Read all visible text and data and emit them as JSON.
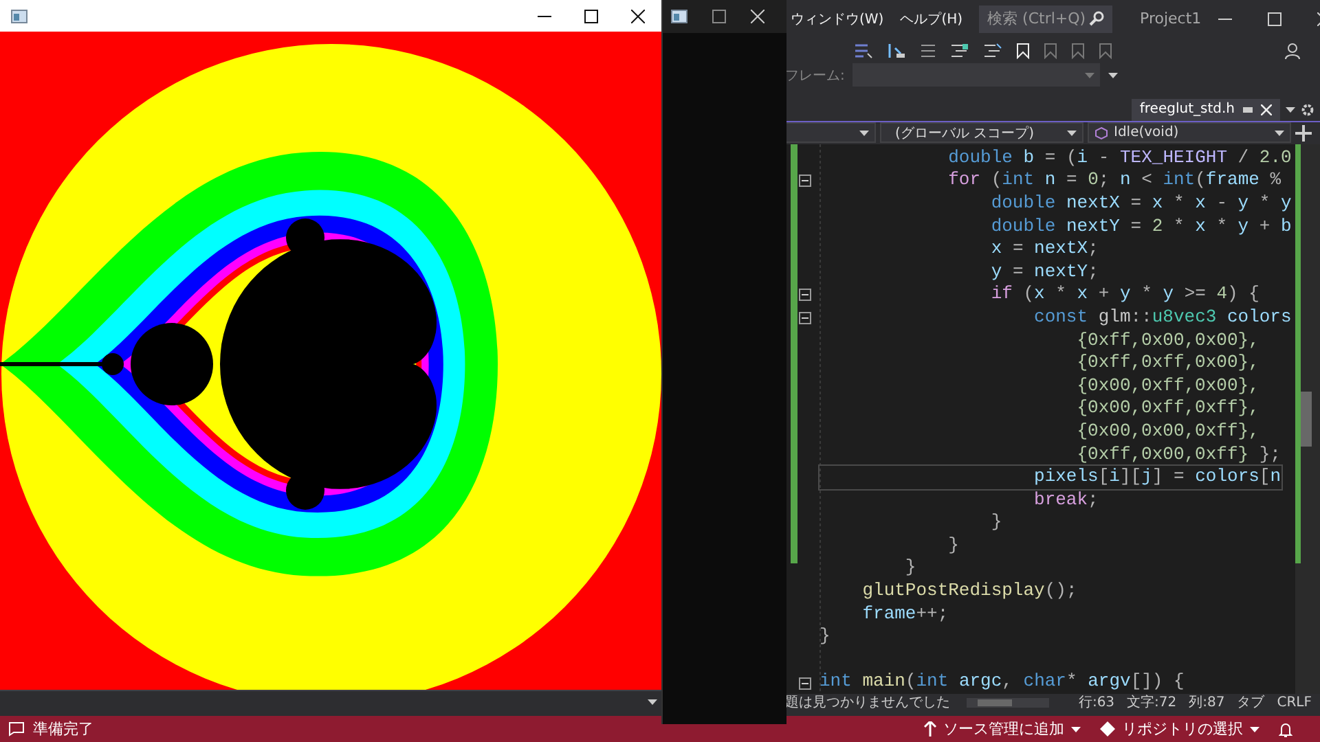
{
  "menu": [
    "ウィンドウ(W)",
    "ヘルプ(H)"
  ],
  "search": {
    "placeholder": "検索 (Ctrl+Q)"
  },
  "project_name": "Project1",
  "debug_toolbar": {
    "frame_label": "フレーム:",
    "disabled": true
  },
  "document_tab": {
    "title": "freeglut_std.h",
    "selected": true
  },
  "navigation_bar": [
    "(グローバル スコープ)",
    "Idle(void)"
  ],
  "code_lines": [
    {
      "foldable": false,
      "current": false,
      "tokens": [
        {
          "kind": "keyword",
          "text": "\t\t\tdouble"
        },
        {
          "kind": "variable",
          "text": " b"
        },
        {
          "kind": "punctuation",
          "text": " = ("
        },
        {
          "kind": "variable",
          "text": "i"
        },
        {
          "kind": "punctuation",
          "text": " - "
        },
        {
          "kind": "macro",
          "text": "TEX_HEIGHT"
        },
        {
          "kind": "punctuation",
          "text": " / "
        },
        {
          "kind": "number",
          "text": "2.0"
        }
      ]
    },
    {
      "foldable": true,
      "current": false,
      "tokens": [
        {
          "kind": "control",
          "text": "\t\t\tfor"
        },
        {
          "kind": "punctuation",
          "text": " ("
        },
        {
          "kind": "keyword",
          "text": "int"
        },
        {
          "kind": "variable",
          "text": " n"
        },
        {
          "kind": "punctuation",
          "text": " = "
        },
        {
          "kind": "number",
          "text": "0"
        },
        {
          "kind": "punctuation",
          "text": "; "
        },
        {
          "kind": "variable",
          "text": "n"
        },
        {
          "kind": "punctuation",
          "text": " < "
        },
        {
          "kind": "keyword",
          "text": "int"
        },
        {
          "kind": "punctuation",
          "text": "("
        },
        {
          "kind": "variable",
          "text": "frame"
        },
        {
          "kind": "punctuation",
          "text": " %"
        }
      ]
    },
    {
      "foldable": false,
      "current": false,
      "tokens": [
        {
          "kind": "keyword",
          "text": "\t\t\t\tdouble"
        },
        {
          "kind": "variable",
          "text": " nextX"
        },
        {
          "kind": "punctuation",
          "text": " = "
        },
        {
          "kind": "variable",
          "text": "x"
        },
        {
          "kind": "punctuation",
          "text": " * "
        },
        {
          "kind": "variable",
          "text": "x"
        },
        {
          "kind": "punctuation",
          "text": " - "
        },
        {
          "kind": "variable",
          "text": "y"
        },
        {
          "kind": "punctuation",
          "text": " * "
        },
        {
          "kind": "variable",
          "text": "y"
        }
      ]
    },
    {
      "foldable": false,
      "current": false,
      "tokens": [
        {
          "kind": "keyword",
          "text": "\t\t\t\tdouble"
        },
        {
          "kind": "variable",
          "text": " nextY"
        },
        {
          "kind": "punctuation",
          "text": " = "
        },
        {
          "kind": "number",
          "text": "2"
        },
        {
          "kind": "punctuation",
          "text": " * "
        },
        {
          "kind": "variable",
          "text": "x"
        },
        {
          "kind": "punctuation",
          "text": " * "
        },
        {
          "kind": "variable",
          "text": "y"
        },
        {
          "kind": "punctuation",
          "text": " + "
        },
        {
          "kind": "variable",
          "text": "b"
        }
      ]
    },
    {
      "foldable": false,
      "current": false,
      "tokens": [
        {
          "kind": "variable",
          "text": "\t\t\t\tx"
        },
        {
          "kind": "punctuation",
          "text": " = "
        },
        {
          "kind": "variable",
          "text": "nextX"
        },
        {
          "kind": "punctuation",
          "text": ";"
        }
      ]
    },
    {
      "foldable": false,
      "current": false,
      "tokens": [
        {
          "kind": "variable",
          "text": "\t\t\t\ty"
        },
        {
          "kind": "punctuation",
          "text": " = "
        },
        {
          "kind": "variable",
          "text": "nextY"
        },
        {
          "kind": "punctuation",
          "text": ";"
        }
      ]
    },
    {
      "foldable": true,
      "current": false,
      "tokens": [
        {
          "kind": "control",
          "text": "\t\t\t\tif"
        },
        {
          "kind": "punctuation",
          "text": " ("
        },
        {
          "kind": "variable",
          "text": "x"
        },
        {
          "kind": "punctuation",
          "text": " * "
        },
        {
          "kind": "variable",
          "text": "x"
        },
        {
          "kind": "punctuation",
          "text": " + "
        },
        {
          "kind": "variable",
          "text": "y"
        },
        {
          "kind": "punctuation",
          "text": " * "
        },
        {
          "kind": "variable",
          "text": "y"
        },
        {
          "kind": "punctuation",
          "text": " >= "
        },
        {
          "kind": "number",
          "text": "4"
        },
        {
          "kind": "punctuation",
          "text": ") {"
        }
      ]
    },
    {
      "foldable": true,
      "current": false,
      "tokens": [
        {
          "kind": "keyword",
          "text": "\t\t\t\t\tconst "
        },
        {
          "kind": "namespace",
          "text": "glm"
        },
        {
          "kind": "punctuation",
          "text": "::"
        },
        {
          "kind": "type",
          "text": "u8vec3"
        },
        {
          "kind": "variable",
          "text": " colors"
        }
      ]
    },
    {
      "foldable": false,
      "current": false,
      "tokens": [
        {
          "kind": "number",
          "text": "\t\t\t\t\t\t{0xff,0x00,0x00},"
        }
      ]
    },
    {
      "foldable": false,
      "current": false,
      "tokens": [
        {
          "kind": "number",
          "text": "\t\t\t\t\t\t{0xff,0xff,0x00},"
        }
      ]
    },
    {
      "foldable": false,
      "current": false,
      "tokens": [
        {
          "kind": "number",
          "text": "\t\t\t\t\t\t{0x00,0xff,0x00},"
        }
      ]
    },
    {
      "foldable": false,
      "current": false,
      "tokens": [
        {
          "kind": "number",
          "text": "\t\t\t\t\t\t{0x00,0xff,0xff},"
        }
      ]
    },
    {
      "foldable": false,
      "current": false,
      "tokens": [
        {
          "kind": "number",
          "text": "\t\t\t\t\t\t{0x00,0x00,0xff},"
        }
      ]
    },
    {
      "foldable": false,
      "current": false,
      "tokens": [
        {
          "kind": "number",
          "text": "\t\t\t\t\t\t{0xff,0x00,0xff}"
        },
        {
          "kind": "punctuation",
          "text": " };"
        }
      ]
    },
    {
      "foldable": false,
      "current": true,
      "tokens": [
        {
          "kind": "variable",
          "text": "\t\t\t\t\tpixels"
        },
        {
          "kind": "punctuation",
          "text": "["
        },
        {
          "kind": "variable",
          "text": "i"
        },
        {
          "kind": "punctuation",
          "text": "]["
        },
        {
          "kind": "variable",
          "text": "j"
        },
        {
          "kind": "punctuation",
          "text": "] = "
        },
        {
          "kind": "variable",
          "text": "colors"
        },
        {
          "kind": "punctuation",
          "text": "["
        },
        {
          "kind": "variable",
          "text": "n"
        }
      ]
    },
    {
      "foldable": false,
      "current": false,
      "tokens": [
        {
          "kind": "control",
          "text": "\t\t\t\t\tbreak"
        },
        {
          "kind": "punctuation",
          "text": ";"
        }
      ]
    },
    {
      "foldable": false,
      "current": false,
      "tokens": [
        {
          "kind": "punctuation",
          "text": "\t\t\t\t}"
        }
      ]
    },
    {
      "foldable": false,
      "current": false,
      "tokens": [
        {
          "kind": "punctuation",
          "text": "\t\t\t}"
        }
      ]
    },
    {
      "foldable": false,
      "current": false,
      "tokens": [
        {
          "kind": "punctuation",
          "text": "\t\t}"
        }
      ]
    },
    {
      "foldable": false,
      "current": false,
      "tokens": [
        {
          "kind": "function",
          "text": "\tglutPostRedisplay"
        },
        {
          "kind": "punctuation",
          "text": "();"
        }
      ]
    },
    {
      "foldable": false,
      "current": false,
      "tokens": [
        {
          "kind": "variable",
          "text": "\tframe"
        },
        {
          "kind": "punctuation",
          "text": "++;"
        }
      ]
    },
    {
      "foldable": false,
      "current": false,
      "tokens": [
        {
          "kind": "punctuation",
          "text": "}"
        }
      ]
    },
    {
      "foldable": true,
      "current": false,
      "blank_before": true,
      "tokens": [
        {
          "kind": "keyword",
          "text": "int "
        },
        {
          "kind": "function",
          "text": "main"
        },
        {
          "kind": "punctuation",
          "text": "("
        },
        {
          "kind": "keyword",
          "text": "int"
        },
        {
          "kind": "variable",
          "text": " argc"
        },
        {
          "kind": "punctuation",
          "text": ", "
        },
        {
          "kind": "keyword",
          "text": "char"
        },
        {
          "kind": "punctuation",
          "text": "* "
        },
        {
          "kind": "variable",
          "text": "argv"
        },
        {
          "kind": "punctuation",
          "text": "[]) {"
        }
      ]
    }
  ],
  "editor_status": {
    "message": "題は見つかりませんでした",
    "line": "行:63",
    "char": "文字:72",
    "column": "列:87",
    "indent": "タブ",
    "line_ending": "CRLF"
  },
  "status_bar": {
    "ready": "準備完了",
    "source_control": "ソース管理に追加",
    "repository": "リポジトリの選択"
  }
}
